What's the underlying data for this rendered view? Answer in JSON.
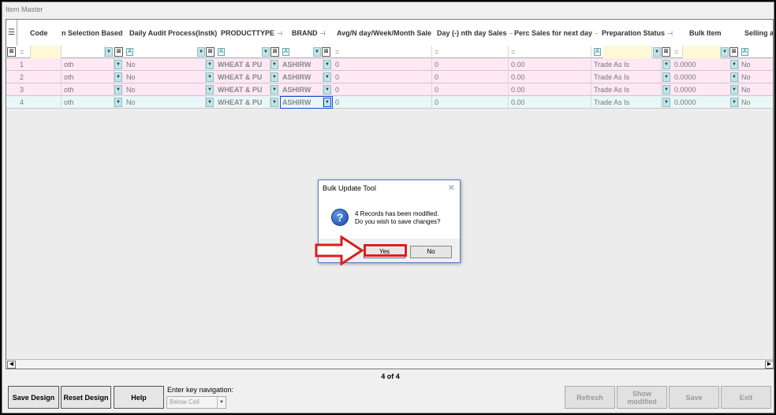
{
  "window": {
    "title": "Item Master"
  },
  "grid": {
    "columns": [
      {
        "label": "Code"
      },
      {
        "label": "n Selection Based"
      },
      {
        "label": "Daily Audit Process(Instk)"
      },
      {
        "label": "PRODUCTTYPE"
      },
      {
        "label": "BRAND"
      },
      {
        "label": "Avg/N day/Week/Month Sale"
      },
      {
        "label": "Day (-) nth day Sales"
      },
      {
        "label": "Perc Sales for next day"
      },
      {
        "label": "Preparation Status"
      },
      {
        "label": "Bulk Item"
      },
      {
        "label": "Selling an"
      }
    ],
    "filter_op": "=",
    "rows": [
      {
        "code": "1",
        "selection": "oth",
        "audit": "No",
        "product_type": "WHEAT & PU",
        "brand": "ASHIRW",
        "avg": "0",
        "day_sales": "0",
        "perc": "0.00",
        "prep": "Trade As Is",
        "bulk": "0.0000",
        "selling": "No"
      },
      {
        "code": "2",
        "selection": "oth",
        "audit": "No",
        "product_type": "WHEAT & PU",
        "brand": "ASHIRW",
        "avg": "0",
        "day_sales": "0",
        "perc": "0.00",
        "prep": "Trade As Is",
        "bulk": "0.0000",
        "selling": "No"
      },
      {
        "code": "3",
        "selection": "oth",
        "audit": "No",
        "product_type": "WHEAT & PU",
        "brand": "ASHIRW",
        "avg": "0",
        "day_sales": "0",
        "perc": "0.00",
        "prep": "Trade As Is",
        "bulk": "0.0000",
        "selling": "No"
      },
      {
        "code": "4",
        "selection": "oth",
        "audit": "No",
        "product_type": "WHEAT & PU",
        "brand": "ASHIRW",
        "avg": "0",
        "day_sales": "0",
        "perc": "0.00",
        "prep": "Trade As Is",
        "bulk": "0.0000",
        "selling": "No"
      }
    ],
    "row_colors": [
      "#fde8f4",
      "#fde8f4",
      "#fde8f4",
      "#eaf7f8"
    ]
  },
  "record_count": "4 of 4",
  "buttons": {
    "save_design": "Save Design",
    "reset_design": "Reset Design",
    "help": "Help",
    "refresh": "Refresh",
    "show_modified": "Show modified",
    "save": "Save",
    "exit": "Exit"
  },
  "navigation": {
    "label": "Enter key navigation:",
    "value": "Below Cell"
  },
  "dialog": {
    "title": "Bulk Update Tool",
    "line1": "4 Records has been modified.",
    "line2": "Do you wish to save changes?",
    "yes": "Yes",
    "no": "No"
  },
  "colors": {
    "highlight": "#d71f1f",
    "dialog_border": "#5a7cc0",
    "row_pink": "#fde8f4",
    "row_cyan": "#eaf7f8"
  }
}
